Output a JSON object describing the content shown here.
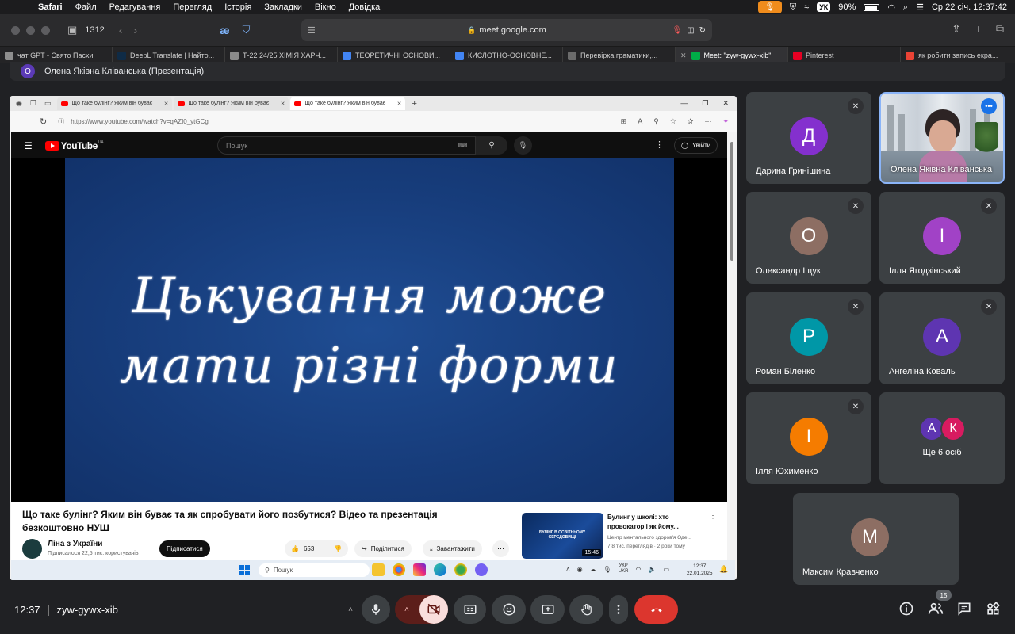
{
  "menubar": {
    "app_name": "Safari",
    "menus": [
      "Файл",
      "Редагування",
      "Перегляд",
      "Історія",
      "Закладки",
      "Вікно",
      "Довідка"
    ],
    "keyboard_layout": "УК",
    "battery": "90%",
    "datetime": "Ср 22 січ.  12:37:42"
  },
  "safari": {
    "tab_count": "1312",
    "address": "meet.google.com"
  },
  "browser_tabs": [
    {
      "label": "чат GPT - Свято Пасхи",
      "color": "#8e8e8e"
    },
    {
      "label": "DeepL Translate | Найто...",
      "color": "#0f2b46"
    },
    {
      "label": "Т-22 24/25 ХІМІЯ ХАРЧ...",
      "color": "#8a8a8a"
    },
    {
      "label": "ТЕОРЕТИЧНІ ОСНОВИ...",
      "color": "#4285f4"
    },
    {
      "label": "КИСЛОТНО-ОСНОВНЕ...",
      "color": "#4285f4"
    },
    {
      "label": "Перевірка граматики,...",
      "color": "#6b6b6b"
    },
    {
      "label": "Meet: \"zyw-gywx-xib\"",
      "color": "#00ac47"
    },
    {
      "label": "Pinterest",
      "color": "#e60023"
    },
    {
      "label": "як робити запись екра...",
      "color": "#ea4335"
    }
  ],
  "presenter": {
    "initial": "О",
    "label": "Олена Яківна Кліванська (Презентація)"
  },
  "shared": {
    "edge_tabs": [
      "Що таке булінг? Яким він буває",
      "Що таке булінг? Яким він буває",
      "Що таке булінг? Яким він буває"
    ],
    "edge_url": "https://www.youtube.com/watch?v=qAZI0_ytGCg",
    "yt_brand": "YouTube",
    "yt_region": "UA",
    "search_placeholder": "Пошук",
    "signin": "Увійти",
    "slide_line1": "Цькування може",
    "slide_line2": "мати різні форми",
    "video_title": "Що таке булінг? Яким він буває та як спробувати його позбутися? Відео та презентація безкоштовно НУШ",
    "channel_name": "Ліна з України",
    "channel_subs": "Підписалося 22,5 тис. користувачів",
    "subscribe": "Підписатися",
    "likes": "653",
    "share": "Поділитися",
    "download": "Завантажити",
    "rec_thumb_text": "БУЛІНГ В ОСВІТНЬОМУ СЕРЕДОВИЩІ",
    "rec_duration": "15:46",
    "rec_title": "Булинг у школі: хто провокатор і як йому...",
    "rec_channel": "Центр ментального здоров'я Оде...",
    "rec_stats": "7,8 тис. переглядів · 2 роки тому",
    "taskbar_search": "Пошук",
    "tray_lang_1": "УКР",
    "tray_lang_2": "UKR",
    "tray_time": "12:37",
    "tray_date": "22.01.2025"
  },
  "participants": [
    {
      "name": "Дарина Гринішина",
      "initial": "Д",
      "color": "#8430ce"
    },
    {
      "name": "Олена Яківна Кліванська",
      "initial": "",
      "color": ""
    },
    {
      "name": "Олександр Іщук",
      "initial": "О",
      "color": "#8d6e63"
    },
    {
      "name": "Ілля Ягодзінський",
      "initial": "І",
      "color": "#a142c6"
    },
    {
      "name": "Роман Біленко",
      "initial": "Р",
      "color": "#0097a7"
    },
    {
      "name": "Ангеліна Коваль",
      "initial": "А",
      "color": "#5e35b1"
    },
    {
      "name": "Ілля Юхименко",
      "initial": "І",
      "color": "#f57c00"
    },
    {
      "name": "Максим Кравченко",
      "initial": "М",
      "color": "#8d6e63"
    }
  ],
  "others": {
    "avatars": [
      {
        "initial": "А",
        "color": "#5e35b1"
      },
      {
        "initial": "К",
        "color": "#d81b60"
      }
    ],
    "label": "Ще 6 осіб"
  },
  "bottom": {
    "time": "12:37",
    "meeting_code": "zyw-gywx-xib",
    "people_count": "15"
  }
}
